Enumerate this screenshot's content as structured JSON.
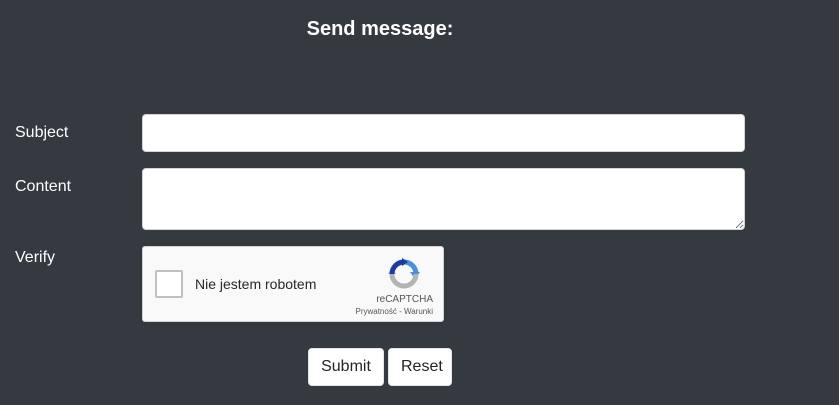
{
  "form": {
    "title": "Send message:",
    "subject_label": "Subject",
    "subject_value": "",
    "content_label": "Content",
    "content_value": "",
    "verify_label": "Verify"
  },
  "recaptcha": {
    "checkbox_label": "Nie jestem robotem",
    "brand": "reCAPTCHA",
    "privacy_link": "Prywatność",
    "separator": " - ",
    "terms_link": "Warunki"
  },
  "buttons": {
    "submit": "Submit",
    "reset": "Reset"
  },
  "colors": {
    "background": "#343a40",
    "text": "#ffffff",
    "recaptcha_blue": "#4a90e2",
    "recaptcha_gray": "#b4b4b4"
  },
  "icons": {
    "recaptcha_logo": "recaptcha-logo-icon"
  }
}
